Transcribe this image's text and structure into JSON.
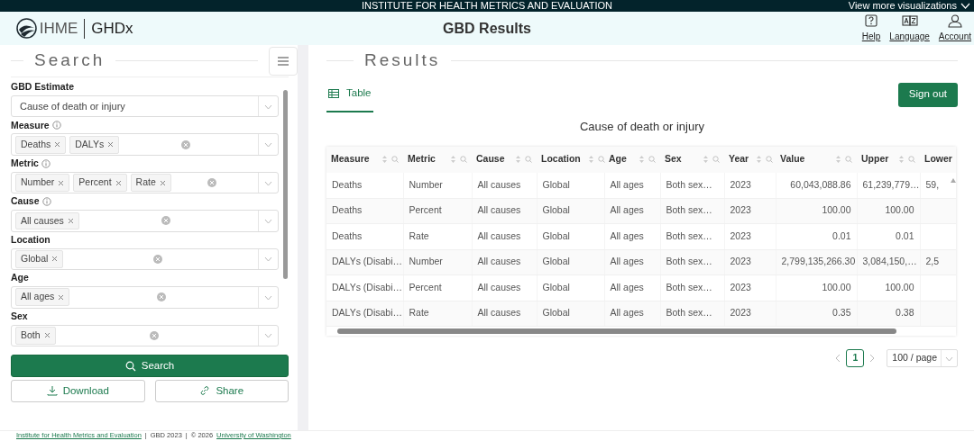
{
  "top_bar": {
    "title": "INSTITUTE FOR HEALTH METRICS AND EVALUATION",
    "menu": "View more visualizations"
  },
  "header": {
    "logo": "IHME",
    "product": "GHDx",
    "title": "GBD Results",
    "actions": [
      {
        "label": "Help",
        "kind": "help"
      },
      {
        "label": "Language",
        "kind": "language"
      },
      {
        "label": "Account",
        "kind": "account"
      }
    ]
  },
  "search_panel": {
    "title": "Search",
    "filters": [
      {
        "label": "GBD Estimate",
        "info": false,
        "value": "Cause of death or injury"
      },
      {
        "label": "Measure",
        "info": true,
        "tags": [
          "Deaths",
          "DALYs"
        ]
      },
      {
        "label": "Metric",
        "info": true,
        "tags": [
          "Number",
          "Percent",
          "Rate"
        ]
      },
      {
        "label": "Cause",
        "info": true,
        "tags": [
          "All causes"
        ]
      },
      {
        "label": "Location",
        "info": false,
        "tags": [
          "Global"
        ]
      },
      {
        "label": "Age",
        "info": false,
        "tags": [
          "All ages"
        ]
      },
      {
        "label": "Sex",
        "info": false,
        "tags": [
          "Both"
        ]
      }
    ],
    "buttons": [
      {
        "label": "Search",
        "kind": "search"
      },
      {
        "label": "Download",
        "kind": "download"
      },
      {
        "label": "Share",
        "kind": "share"
      }
    ]
  },
  "results": {
    "title": "Results",
    "tabs": [
      {
        "label": "Table",
        "selected": true
      }
    ],
    "sign_out": "Sign out",
    "table_title": "Cause of death or injury",
    "table": {
      "columns": [
        {
          "label": "Measure",
          "numeric": false
        },
        {
          "label": "Metric",
          "numeric": false
        },
        {
          "label": "Cause",
          "numeric": false
        },
        {
          "label": "Location",
          "numeric": false
        },
        {
          "label": "Age",
          "numeric": false
        },
        {
          "label": "Sex",
          "numeric": false
        },
        {
          "label": "Year",
          "numeric": false
        },
        {
          "label": "Value",
          "numeric": true
        },
        {
          "label": "Upper",
          "numeric": true
        },
        {
          "label": "Lower",
          "numeric": false
        }
      ],
      "rows": [
        [
          "Deaths",
          "Number",
          "All causes",
          "Global",
          "All ages",
          "Both sex…",
          "2023",
          "60,043,088.86",
          "61,239,779…",
          "59,"
        ],
        [
          "Deaths",
          "Percent",
          "All causes",
          "Global",
          "All ages",
          "Both sex…",
          "2023",
          "100.00",
          "100.00",
          null
        ],
        [
          "Deaths",
          "Rate",
          "All causes",
          "Global",
          "All ages",
          "Both sex…",
          "2023",
          "0.01",
          "0.01",
          null
        ],
        [
          "DALYs (Disabi…",
          "Number",
          "All causes",
          "Global",
          "All ages",
          "Both sex…",
          "2023",
          "2,799,135,266.30",
          "3,084,150,…",
          "2,5"
        ],
        [
          "DALYs (Disabi…",
          "Percent",
          "All causes",
          "Global",
          "All ages",
          "Both sex…",
          "2023",
          "100.00",
          "100.00",
          null
        ],
        [
          "DALYs (Disabi…",
          "Rate",
          "All causes",
          "Global",
          "All ages",
          "Both sex…",
          "2023",
          "0.35",
          "0.38",
          null
        ]
      ]
    },
    "pagination": {
      "pages": [
        {
          "label": "1",
          "selected": true
        }
      ],
      "page_size": "100 / page"
    }
  },
  "footer": [
    {
      "text": "Institute for Health Metrics and Evaluation",
      "link": true
    },
    {
      "text": "|",
      "link": false
    },
    {
      "text": "GBD 2023",
      "link": false
    },
    {
      "text": "|",
      "link": false
    },
    {
      "text": "© 2026",
      "link": false
    },
    {
      "text": "University of Washington",
      "link": true
    }
  ]
}
